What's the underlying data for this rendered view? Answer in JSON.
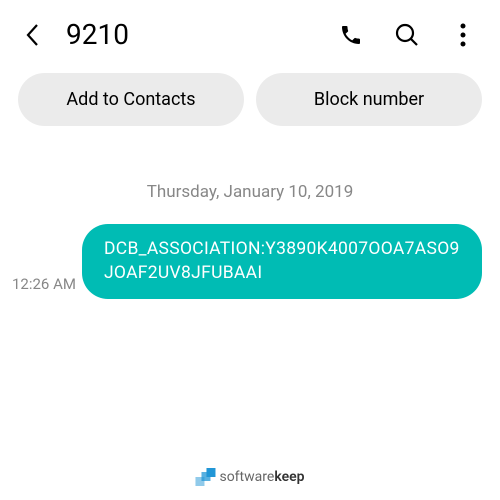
{
  "header": {
    "title": "9210"
  },
  "actions": {
    "add_contacts_label": "Add to Contacts",
    "block_number_label": "Block number"
  },
  "conversation": {
    "date_label": "Thursday, January 10, 2019",
    "messages": [
      {
        "time": "12:26 AM",
        "text": "DCB_ASSOCIATION:Y3890K4007OOA7ASO9JOAF2UV8JFUBAAI"
      }
    ]
  },
  "footer": {
    "logo_light": "software",
    "logo_bold": "keep"
  }
}
